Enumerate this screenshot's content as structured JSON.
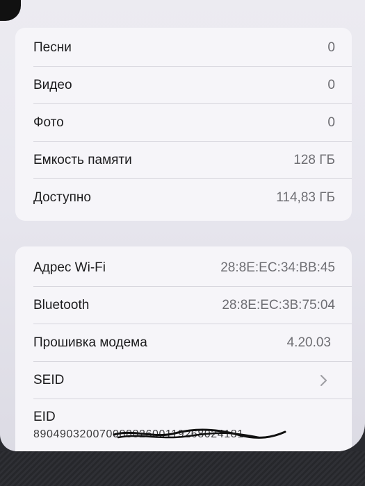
{
  "storage": {
    "rows": [
      {
        "label": "Песни",
        "value": "0"
      },
      {
        "label": "Видео",
        "value": "0"
      },
      {
        "label": "Фото",
        "value": "0"
      },
      {
        "label": "Емкость памяти",
        "value": "128 ГБ"
      },
      {
        "label": "Доступно",
        "value": "114,83 ГБ"
      }
    ]
  },
  "network": {
    "rows": [
      {
        "label": "Адрес Wi-Fi",
        "value": "28:8E:EC:34:BB:45"
      },
      {
        "label": "Bluetooth",
        "value": "28:8E:EC:3B:75:04"
      },
      {
        "label": "Прошивка модема",
        "value": "4.20.03"
      },
      {
        "label": "SEID"
      },
      {
        "label": "EID",
        "value": "89049032007008882600119268024181"
      }
    ]
  },
  "icons": {
    "seid_chevron": "chevron-right-icon",
    "redaction": "pen-scribble"
  }
}
